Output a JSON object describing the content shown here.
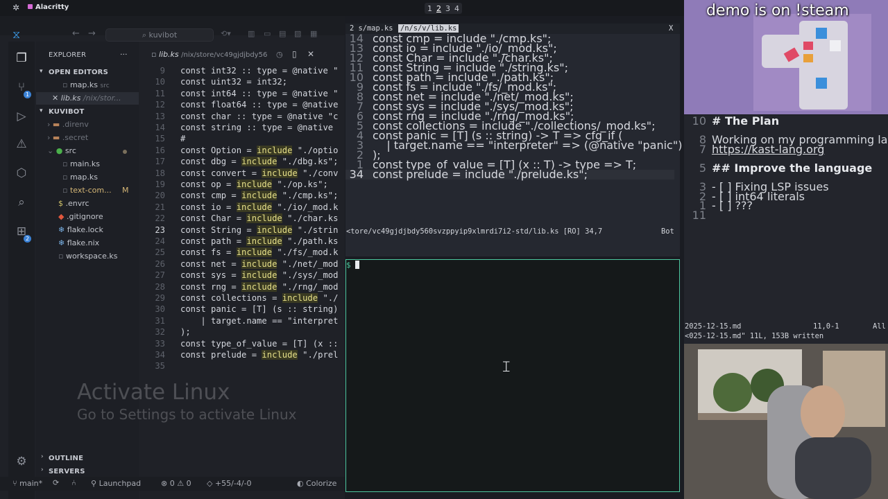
{
  "topbar": {
    "app_name": "Alacritty",
    "workspaces": [
      "1",
      "2",
      "3",
      "4"
    ],
    "active_workspace": "2"
  },
  "vscode": {
    "command_center": "kuvibot",
    "sidebar": {
      "explorer_label": "EXPLORER",
      "open_editors_label": "OPEN EDITORS",
      "open_editors": [
        {
          "name": "map.ks",
          "detail": "src"
        },
        {
          "name": "lib.ks",
          "detail": "/nix/stor..."
        }
      ],
      "project_label": "KUVIBOT",
      "tree": [
        {
          "name": ".direnv",
          "kind": "folder",
          "depth": 1
        },
        {
          "name": ".secret",
          "kind": "folder",
          "depth": 1
        },
        {
          "name": "src",
          "kind": "folder-open",
          "depth": 1
        },
        {
          "name": "main.ks",
          "kind": "file",
          "depth": 2
        },
        {
          "name": "map.ks",
          "kind": "file",
          "depth": 2
        },
        {
          "name": "text-com...",
          "kind": "file",
          "depth": 2,
          "badge": "M"
        },
        {
          "name": ".envrc",
          "kind": "file",
          "depth": 1
        },
        {
          "name": ".gitignore",
          "kind": "file",
          "depth": 1
        },
        {
          "name": "flake.lock",
          "kind": "file",
          "depth": 1
        },
        {
          "name": "flake.nix",
          "kind": "file",
          "depth": 1
        },
        {
          "name": "workspace.ks",
          "kind": "file",
          "depth": 1
        }
      ],
      "outline_label": "OUTLINE",
      "servers_label": "SERVERS"
    },
    "tab": {
      "name": "lib.ks",
      "path": "/nix/store/vc49gjdjbdy56"
    },
    "code_lines": [
      {
        "n": "9",
        "text": "const int32 :: type = @native \""
      },
      {
        "n": "10",
        "text": "const uint32 = int32;"
      },
      {
        "n": "11",
        "text": "const int64 :: type = @native \""
      },
      {
        "n": "12",
        "text": "const float64 :: type = @native"
      },
      {
        "n": "13",
        "text": "const char :: type = @native \"c"
      },
      {
        "n": "14",
        "text": "const string :: type = @native"
      },
      {
        "n": "15",
        "text": "#"
      },
      {
        "n": "16",
        "pre": "const Option = ",
        "kw": "include",
        "post": " \"./optio"
      },
      {
        "n": "17",
        "pre": "const dbg = ",
        "kw": "include",
        "post": " \"./dbg.ks\";"
      },
      {
        "n": "18",
        "pre": "const convert = ",
        "kw": "include",
        "post": " \"./conv"
      },
      {
        "n": "19",
        "pre": "const op = ",
        "kw": "include",
        "post": " \"./op.ks\";"
      },
      {
        "n": "20",
        "pre": "const cmp = ",
        "kw": "include",
        "post": " \"./cmp.ks\";"
      },
      {
        "n": "21",
        "pre": "const io = ",
        "kw": "include",
        "post": " \"./io/_mod.k"
      },
      {
        "n": "22",
        "pre": "const Char = ",
        "kw": "include",
        "post": " \"./char.ks"
      },
      {
        "n": "23",
        "pre": "const String = ",
        "kw": "include",
        "post": " \"./strin"
      },
      {
        "n": "24",
        "pre": "const path = ",
        "kw": "include",
        "post": " \"./path.ks"
      },
      {
        "n": "25",
        "pre": "const fs = ",
        "kw": "include",
        "post": " \"./fs/_mod.k"
      },
      {
        "n": "26",
        "pre": "const net = ",
        "kw": "include",
        "post": " \"./net/_mod"
      },
      {
        "n": "27",
        "pre": "const sys = ",
        "kw": "include",
        "post": " \"./sys/_mod"
      },
      {
        "n": "28",
        "pre": "const rng = ",
        "kw": "include",
        "post": " \"./rng/_mod"
      },
      {
        "n": "29",
        "pre": "const collections = ",
        "kw": "include",
        "post": " \"./"
      },
      {
        "n": "30",
        "text": "const panic = [T] (s :: string)"
      },
      {
        "n": "31",
        "text": "    | target.name == \"interpret"
      },
      {
        "n": "32",
        "text": ");"
      },
      {
        "n": "33",
        "text": "const type_of_value = [T] (x ::"
      },
      {
        "n": "34",
        "pre": "const prelude = ",
        "kw": "include",
        "post": " \"./prel"
      },
      {
        "n": "35",
        "text": ""
      }
    ],
    "current_line": "23",
    "watermark_title": "Activate Linux",
    "watermark_sub": "Go to Settings to activate Linux",
    "status": {
      "branch": "main*",
      "launchpad": "Launchpad",
      "errors": "0",
      "warnings": "0",
      "diff": "+55/-4/-0",
      "colorize": "Colorize"
    }
  },
  "vim": {
    "tabs": [
      {
        "label": "2 s/map.ks",
        "active": false
      },
      {
        "label": "/n/s/v/lib.ks",
        "active": true
      }
    ],
    "close": "X",
    "lines": [
      {
        "n": "14",
        "text": "const cmp = include \"./cmp.ks\";"
      },
      {
        "n": "13",
        "text": "const io = include \"./io/_mod.ks\";"
      },
      {
        "n": "12",
        "text": "const Char = include \"./char.ks\";"
      },
      {
        "n": "11",
        "text": "const String = include \"./string.ks\";"
      },
      {
        "n": "10",
        "text": "const path = include \"./path.ks\";"
      },
      {
        "n": "9",
        "text": "const fs = include \"./fs/_mod.ks\";"
      },
      {
        "n": "8",
        "text": "const net = include \"./net/_mod.ks\";"
      },
      {
        "n": "7",
        "text": "const sys = include \"./sys/_mod.ks\";"
      },
      {
        "n": "6",
        "text": "const rng = include \"./rng/_mod.ks\";"
      },
      {
        "n": "5",
        "text": "const collections = include \"./collections/_mod.ks\";"
      },
      {
        "n": "4",
        "text": "const panic = [T] (s :: string) -> T => cfg_if ("
      },
      {
        "n": "3",
        "text": "    | target.name == \"interpreter\" => (@native \"panic\") s"
      },
      {
        "n": "2",
        "text": ");"
      },
      {
        "n": "1",
        "text": "const type_of_value = [T] (x :: T) -> type => T;"
      },
      {
        "n": "34",
        "text": "const prelude = include \"./prelude.ks\";"
      }
    ],
    "statusline_left": "<tore/vc49gjdjbdy560svzppyip9xlmrdi7i2-std/lib.ks [RO] 34,7",
    "statusline_right": "Bot"
  },
  "shell": {
    "prompt": "$"
  },
  "stream": {
    "overlay_text": "demo is on !steam"
  },
  "notes": {
    "lines": [
      {
        "n": "10",
        "text": "# The Plan",
        "style": "heading"
      },
      {
        "n": "",
        "text": ""
      },
      {
        "n": "8",
        "text": "Working on my programming language"
      },
      {
        "n": "7",
        "text": "https://kast-lang.org",
        "style": "link"
      },
      {
        "n": "",
        "text": ""
      },
      {
        "n": "5",
        "text": "## Improve the language",
        "style": "heading"
      },
      {
        "n": "",
        "text": ""
      },
      {
        "n": "3",
        "text": "- [ ] Fixing LSP issues",
        "style": "task"
      },
      {
        "n": "2",
        "text": "- [ ] int64 literals",
        "style": "task"
      },
      {
        "n": "1",
        "text": "- [ ] ???",
        "style": "task"
      },
      {
        "n": "11",
        "text": ""
      }
    ],
    "statusline_file": "2025-12-15.md",
    "statusline_pos": "11,0-1",
    "statusline_all": "All",
    "message": "<025-12-15.md\" 11L, 153B written"
  }
}
